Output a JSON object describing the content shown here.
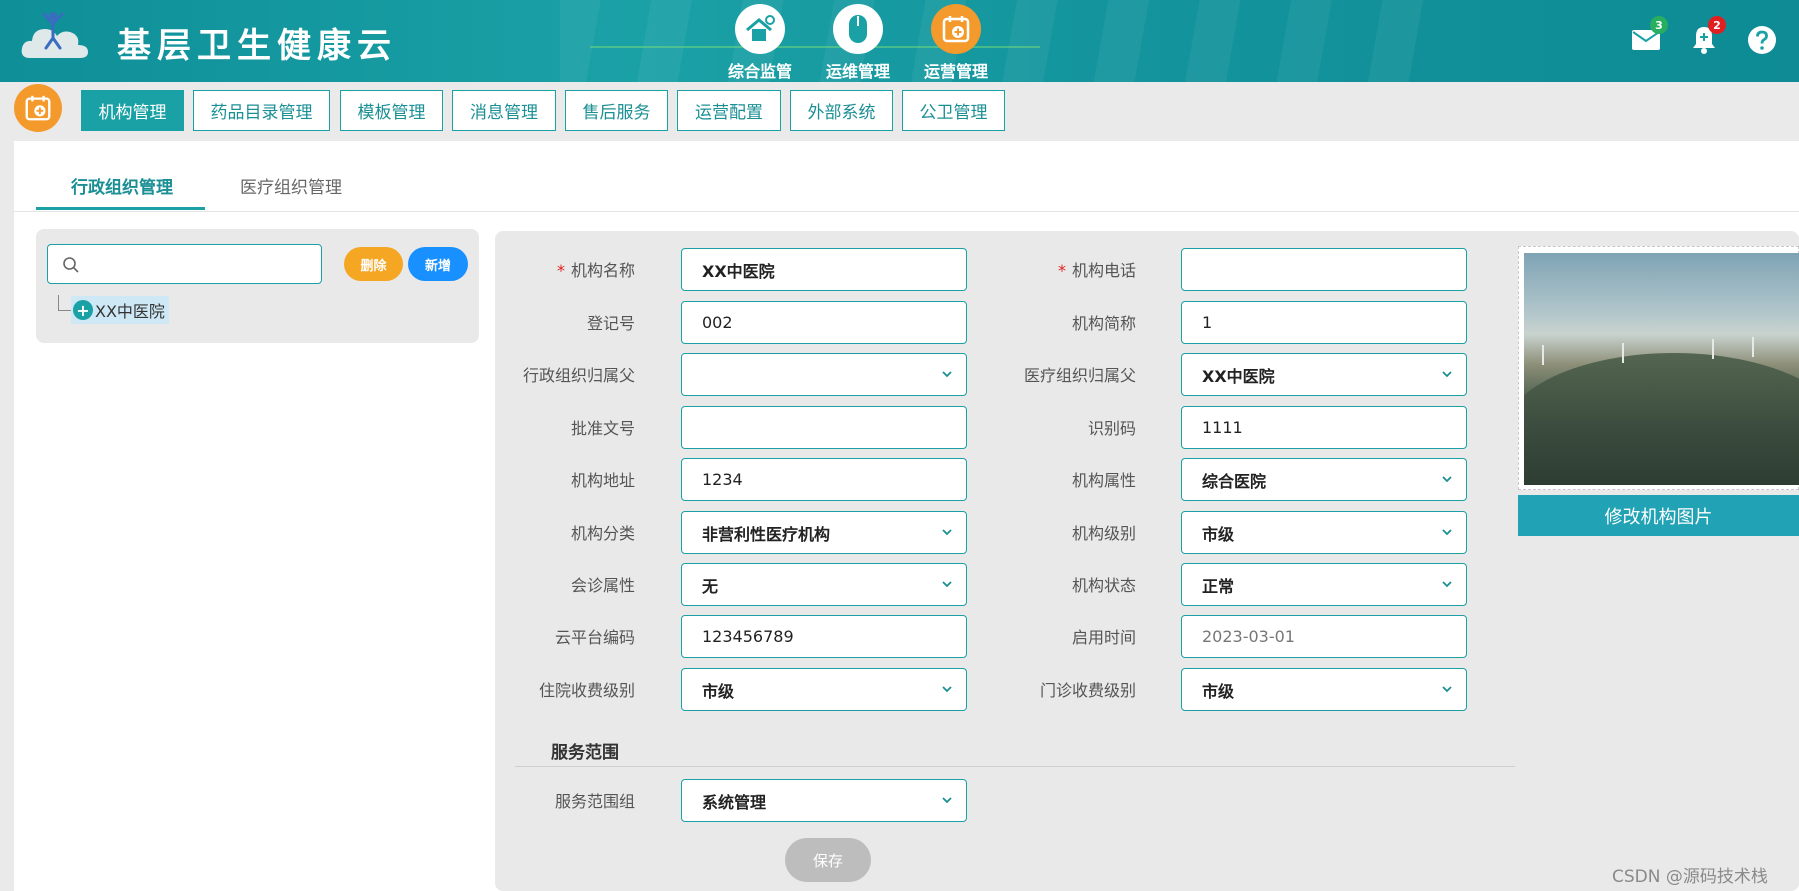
{
  "header": {
    "title": "基层卫生健康云",
    "nav": [
      {
        "label": "综合监管",
        "icon": "house-stethoscope-icon"
      },
      {
        "label": "运维管理",
        "icon": "mouse-icon"
      },
      {
        "label": "运营管理",
        "icon": "calendar-plus-icon"
      }
    ],
    "mail_badge": "3",
    "bell_badge": "2"
  },
  "module_tabs": [
    "机构管理",
    "药品目录管理",
    "模板管理",
    "消息管理",
    "售后服务",
    "运营配置",
    "外部系统",
    "公卫管理"
  ],
  "sub_tabs": [
    "行政组织管理",
    "医疗组织管理"
  ],
  "tree": {
    "search_placeholder": "",
    "delete_label": "删除",
    "add_label": "新增",
    "node": "XX中医院"
  },
  "form": {
    "name": {
      "label": "机构名称",
      "value": "XX中医院"
    },
    "phone": {
      "label": "机构电话",
      "value": ""
    },
    "reg_no": {
      "label": "登记号",
      "value": "002"
    },
    "short_name": {
      "label": "机构简称",
      "value": "1"
    },
    "admin_parent": {
      "label": "行政组织归属父",
      "value": ""
    },
    "medical_parent": {
      "label": "医疗组织归属父",
      "value": "XX中医院"
    },
    "approval_no": {
      "label": "批准文号",
      "value": ""
    },
    "id_code": {
      "label": "识别码",
      "value": "1111"
    },
    "address": {
      "label": "机构地址",
      "value": "1234"
    },
    "attribute": {
      "label": "机构属性",
      "value": "综合医院"
    },
    "category": {
      "label": "机构分类",
      "value": "非营利性医疗机构"
    },
    "level": {
      "label": "机构级别",
      "value": "市级"
    },
    "consult": {
      "label": "会诊属性",
      "value": "无"
    },
    "status": {
      "label": "机构状态",
      "value": "正常"
    },
    "cloud_code": {
      "label": "云平台编码",
      "value": "123456789"
    },
    "start_date": {
      "label": "启用时间",
      "value": "2023-03-01"
    },
    "inpatient_fee": {
      "label": "住院收费级别",
      "value": "市级"
    },
    "outpatient_fee": {
      "label": "门诊收费级别",
      "value": "市级"
    },
    "service_section": "服务范围",
    "service_group": {
      "label": "服务范围组",
      "value": "系统管理"
    },
    "save_label": "保存"
  },
  "photo_button": "修改机构图片",
  "watermark": "CSDN @源码技术栈",
  "colors": {
    "primary": "#1aa1a6",
    "orange": "#f49a2c",
    "blue": "#1890ff",
    "danger": "#e02020"
  }
}
